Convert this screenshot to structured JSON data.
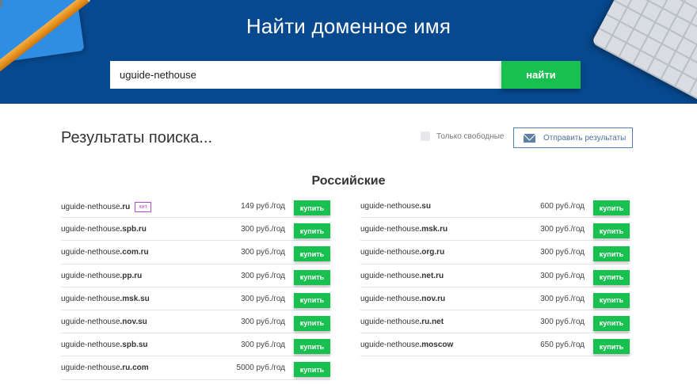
{
  "hero": {
    "title": "Найти доменное имя"
  },
  "search": {
    "value": "uguide-nethouse",
    "button_label": "найти"
  },
  "results": {
    "title": "Результаты поиска...",
    "free_only_label": "Только свободные",
    "free_only_checked": false,
    "send_label": "Отправить результаты"
  },
  "section": {
    "title": "Российские"
  },
  "domains_left": [
    {
      "base": "uguide-nethouse",
      "zone": ".ru",
      "badge": "хит",
      "price": "149 руб./год",
      "buy": "купить"
    },
    {
      "base": "uguide-nethouse",
      "zone": ".spb.ru",
      "badge": "",
      "price": "300 руб./год",
      "buy": "купить"
    },
    {
      "base": "uguide-nethouse",
      "zone": ".com.ru",
      "badge": "",
      "price": "300 руб./год",
      "buy": "купить"
    },
    {
      "base": "uguide-nethouse",
      "zone": ".pp.ru",
      "badge": "",
      "price": "300 руб./год",
      "buy": "купить"
    },
    {
      "base": "uguide-nethouse",
      "zone": ".msk.su",
      "badge": "",
      "price": "300 руб./год",
      "buy": "купить"
    },
    {
      "base": "uguide-nethouse",
      "zone": ".nov.su",
      "badge": "",
      "price": "300 руб./год",
      "buy": "купить"
    },
    {
      "base": "uguide-nethouse",
      "zone": ".spb.su",
      "badge": "",
      "price": "300 руб./год",
      "buy": "купить"
    },
    {
      "base": "uguide-nethouse",
      "zone": ".ru.com",
      "badge": "",
      "price": "5000 руб./год",
      "buy": "купить"
    }
  ],
  "domains_right": [
    {
      "base": "uguide-nethouse",
      "zone": ".su",
      "badge": "",
      "price": "600 руб./год",
      "buy": "купить"
    },
    {
      "base": "uguide-nethouse",
      "zone": ".msk.ru",
      "badge": "",
      "price": "300 руб./год",
      "buy": "купить"
    },
    {
      "base": "uguide-nethouse",
      "zone": ".org.ru",
      "badge": "",
      "price": "300 руб./год",
      "buy": "купить"
    },
    {
      "base": "uguide-nethouse",
      "zone": ".net.ru",
      "badge": "",
      "price": "300 руб./год",
      "buy": "купить"
    },
    {
      "base": "uguide-nethouse",
      "zone": ".nov.ru",
      "badge": "",
      "price": "300 руб./год",
      "buy": "купить"
    },
    {
      "base": "uguide-nethouse",
      "zone": ".ru.net",
      "badge": "",
      "price": "300 руб./год",
      "buy": "купить"
    },
    {
      "base": "uguide-nethouse",
      "zone": ".moscow",
      "badge": "",
      "price": "650 руб./год",
      "buy": "купить"
    }
  ],
  "icons": {
    "send": "mail-icon"
  },
  "colors": {
    "hero_bg": "#07498f",
    "accent_green": "#17c04f",
    "badge_purple": "#b04bc9",
    "outline_blue": "#4f7fb3"
  }
}
